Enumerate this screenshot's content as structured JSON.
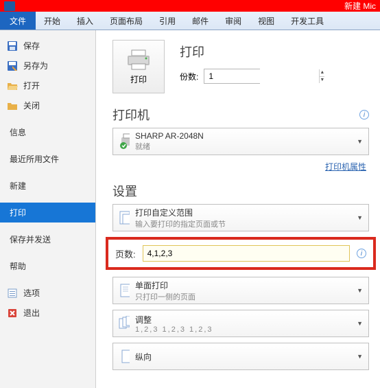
{
  "titlebar": {
    "doc_title": "新建 Mic"
  },
  "ribbon": {
    "file": "文件",
    "tabs": [
      "开始",
      "插入",
      "页面布局",
      "引用",
      "邮件",
      "审阅",
      "视图",
      "开发工具"
    ]
  },
  "sidebar": {
    "save": "保存",
    "save_as": "另存为",
    "open": "打开",
    "close": "关闭",
    "info": "信息",
    "recent": "最近所用文件",
    "new": "新建",
    "print": "打印",
    "save_send": "保存并发送",
    "help": "帮助",
    "options": "选项",
    "exit": "退出"
  },
  "print": {
    "heading": "打印",
    "button": "打印",
    "copies_label": "份数:",
    "copies_value": "1"
  },
  "printer": {
    "heading": "打印机",
    "name": "SHARP AR-2048N",
    "status": "就绪",
    "props_link": "打印机属性"
  },
  "settings": {
    "heading": "设置",
    "range_t1": "打印自定义范围",
    "range_t2": "输入要打印的指定页面或节",
    "pages_label": "页数:",
    "pages_value": "4,1,2,3",
    "duplex_t1": "单面打印",
    "duplex_t2": "只打印一侧的页面",
    "collate_t1": "调整",
    "collate_t2": "1,2,3    1,2,3    1,2,3",
    "orient_t1": "纵向"
  }
}
